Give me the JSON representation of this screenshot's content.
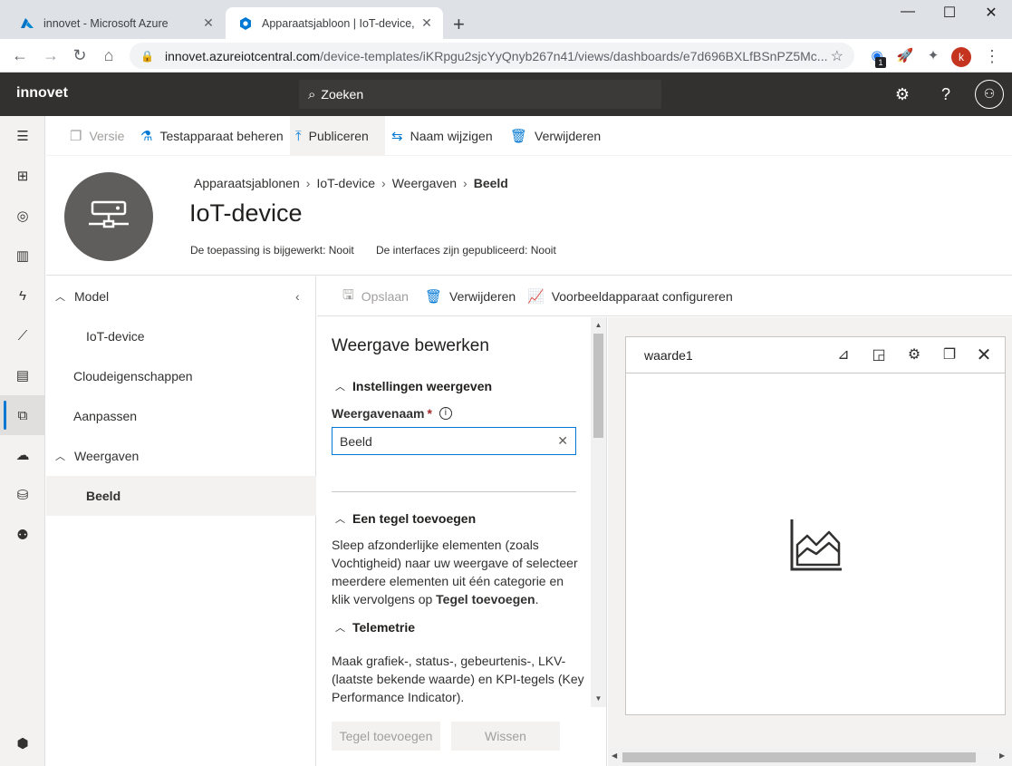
{
  "browser": {
    "tabs": [
      {
        "title": "innovet - Microsoft Azure",
        "active": false
      },
      {
        "title": "Apparaatsjabloon | IoT-device, in",
        "active": true
      }
    ],
    "url_host": "innovet.azureiotcentral.com",
    "url_path": "/device-templates/iKRpgu2sjcYyQnyb267n41/views/dashboards/e7d696BXLfBSnPZ5Mc...",
    "profile_initial": "k",
    "extension_badge": "1"
  },
  "app": {
    "name": "innovet",
    "search_placeholder": "Zoeken"
  },
  "command_bar": {
    "version": "Versie",
    "test_device": "Testapparaat beheren",
    "publish": "Publiceren",
    "rename": "Naam wijzigen",
    "delete": "Verwijderen"
  },
  "header": {
    "breadcrumb": [
      "Apparaatsjablonen",
      "IoT-device",
      "Weergaven",
      "Beeld"
    ],
    "title": "IoT-device",
    "app_status": "De toepassing is bijgewerkt: Nooit",
    "interface_status": "De interfaces zijn gepubliceerd: Nooit"
  },
  "nav": {
    "model": "Model",
    "iot_device": "IoT-device",
    "cloud_props": "Cloudeigenschappen",
    "customize": "Aanpassen",
    "views": "Weergaven",
    "view_item": "Beeld"
  },
  "sub_command": {
    "save": "Opslaan",
    "delete": "Verwijderen",
    "configure": "Voorbeeldapparaat configureren"
  },
  "edit": {
    "title": "Weergave bewerken",
    "settings_section": "Instellingen weergeven",
    "name_label": "Weergavenaam",
    "required_mark": "*",
    "name_value": "Beeld",
    "add_tile_section": "Een tegel toevoegen",
    "add_tile_text_1": "Sleep afzonderlijke elementen (zoals Vochtigheid) naar uw weergave of selecteer meerdere elementen uit één categorie en klik vervolgens op ",
    "add_tile_text_bold": "Tegel toevoegen",
    "add_tile_text_end": ".",
    "telemetry_section": "Telemetrie",
    "telemetry_text": "Maak grafiek-, status-, gebeurtenis-, LKV- (laatste bekende waarde) en KPI-tegels (Key Performance Indicator).",
    "add_tile_button": "Tegel toevoegen",
    "clear_button": "Wissen"
  },
  "tile": {
    "title": "waarde1"
  }
}
